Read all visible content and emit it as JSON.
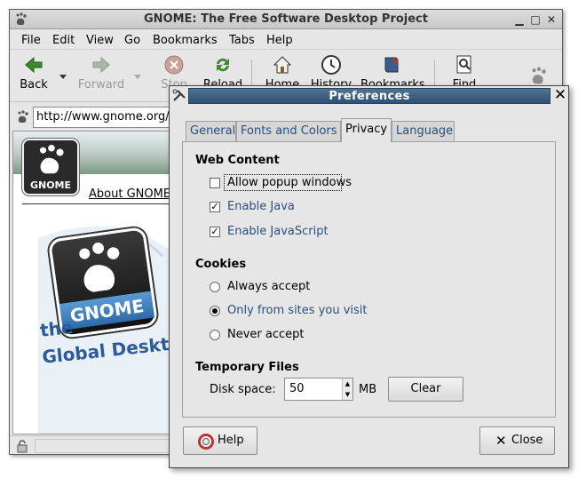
{
  "browser": {
    "title": "GNOME: The Free Software Desktop Project",
    "menu": [
      "File",
      "Edit",
      "View",
      "Go",
      "Bookmarks",
      "Tabs",
      "Help"
    ],
    "toolbar": {
      "back": "Back",
      "forward": "Forward",
      "stop": "Stop",
      "reload": "Reload",
      "home": "Home",
      "history": "History",
      "bookmarks": "Bookmarks",
      "find": "Find"
    },
    "url": "http://www.gnome.org/",
    "page": {
      "logo_word": "GNOME",
      "about_link": "About GNOME",
      "art_line1": "the",
      "art_line2": "Global Desktop",
      "art_logo_word": "GNOME"
    }
  },
  "dialog": {
    "title": "Preferences",
    "tabs": [
      "General",
      "Fonts and Colors",
      "Privacy",
      "Language"
    ],
    "active_tab": "Privacy",
    "web_content": {
      "heading": "Web Content",
      "options": [
        {
          "label": "Allow popup windows",
          "checked": false
        },
        {
          "label": "Enable Java",
          "checked": true
        },
        {
          "label": "Enable JavaScript",
          "checked": true
        }
      ]
    },
    "cookies": {
      "heading": "Cookies",
      "options": [
        {
          "label": "Always accept",
          "selected": false
        },
        {
          "label": "Only from sites you visit",
          "selected": true
        },
        {
          "label": "Never accept",
          "selected": false
        }
      ]
    },
    "temp_files": {
      "heading": "Temporary Files",
      "disk_label": "Disk space:",
      "disk_value": "50",
      "unit": "MB",
      "clear_label": "Clear"
    },
    "help_label": "Help",
    "close_label": "Close",
    "colors": {
      "titlebar": "#3a5d7f",
      "link_text": "#2a4f7c"
    }
  }
}
